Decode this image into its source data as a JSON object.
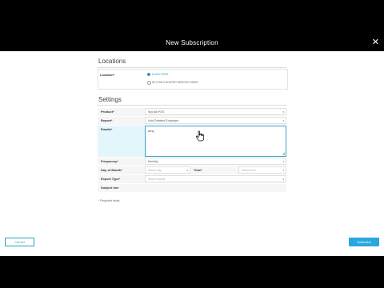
{
  "modal": {
    "title": "New Subscription",
    "close_label": "✕"
  },
  "locations": {
    "title": "Locations",
    "field_label": "Location*",
    "options": [
      {
        "label": "AUSCLOSE5",
        "selected": true
      },
      {
        "label": "SKYTAB COUNTER SERVICE DEMO",
        "selected": false
      }
    ]
  },
  "settings": {
    "title": "Settings",
    "product": {
      "label": "Product*",
      "value": "SkyTab POS"
    },
    "report": {
      "label": "Report*",
      "value": "Void Detailed Employee"
    },
    "emails": {
      "label": "Emails*",
      "value": "amy"
    },
    "frequency": {
      "label": "Frequency*",
      "value": "Monthly"
    },
    "day_of_month": {
      "label": "Day of Month*",
      "placeholder": "Select day"
    },
    "time": {
      "label": "Time*",
      "placeholder": "Select time"
    },
    "export_type": {
      "label": "Export Type*",
      "placeholder": "Select format"
    },
    "subject_line": {
      "label": "Subject line",
      "value": ""
    }
  },
  "required_note": "* Required fields",
  "footer": {
    "cancel_label": "Cancel",
    "subscribe_label": "Subscribe"
  },
  "colors": {
    "accent": "#26a0b8",
    "primary_button": "#2aa8de",
    "header_bg": "#000000"
  }
}
